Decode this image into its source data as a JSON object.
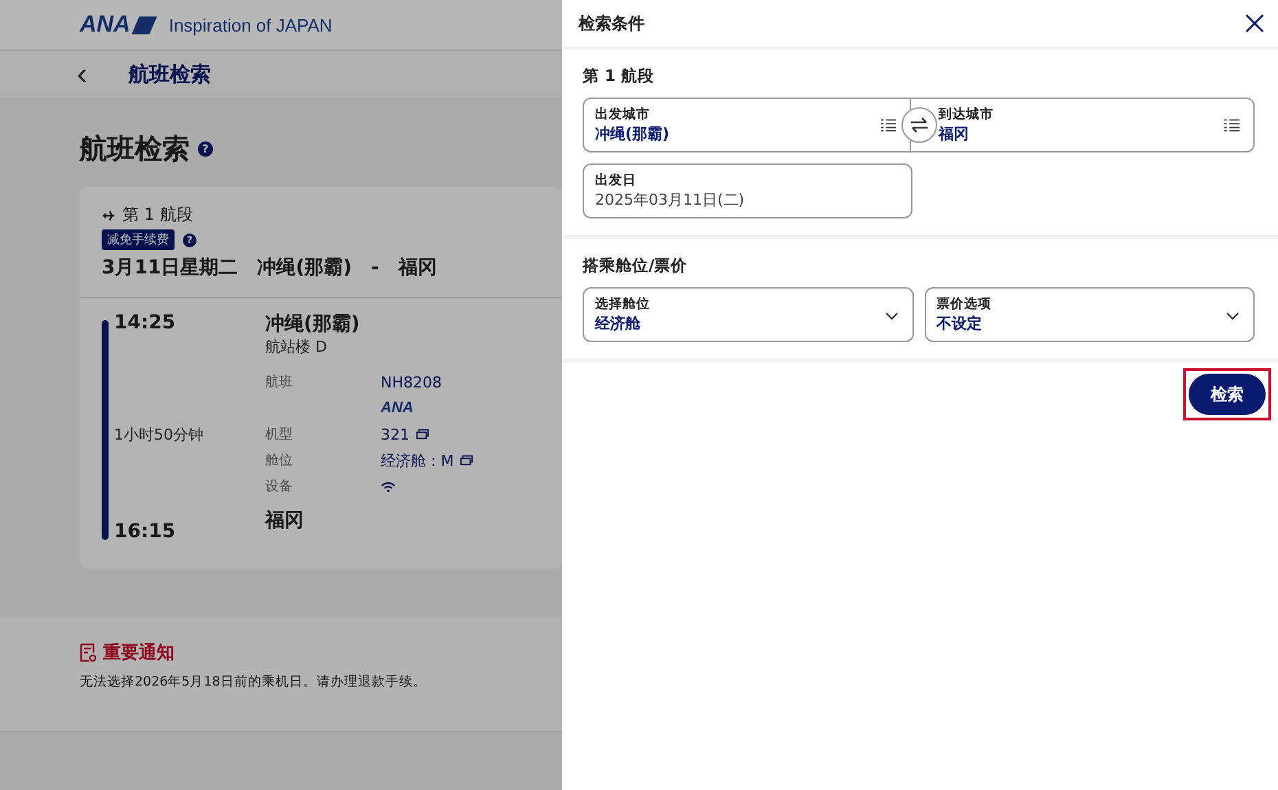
{
  "header": {
    "logo": "ANA",
    "tagline": "Inspiration of JAPAN"
  },
  "nav": {
    "back": "‹",
    "title": "航班检索"
  },
  "page": {
    "title": "航班检索",
    "help": "?",
    "segment": {
      "label": "第 1 航段",
      "badge": "减免手续费",
      "badge_help": "?",
      "route": "3月11日星期二　冲绳(那霸)　-　福冈",
      "departure": {
        "time": "14:25",
        "city": "冲绳(那霸)",
        "terminal": "航站楼 D"
      },
      "duration": "1小时50分钟",
      "details": [
        {
          "label": "航班",
          "value": "NH8208",
          "kind": "text"
        },
        {
          "value": "ANA",
          "kind": "logo"
        },
        {
          "label": "机型",
          "value": "321",
          "kind": "popup"
        },
        {
          "label": "舱位",
          "value": "经济舱 : M",
          "kind": "popup"
        },
        {
          "label": "设备",
          "kind": "wifi"
        }
      ],
      "arrival": {
        "time": "16:15",
        "city": "福冈"
      }
    }
  },
  "notice": {
    "title": "重要通知",
    "text": "无法选择2026年5月18日前的乘机日。请办理退款手续。"
  },
  "drawer": {
    "title": "检索条件",
    "leg": {
      "title": "第 1 航段",
      "from": {
        "label": "出发城市",
        "value": "冲绳(那霸)"
      },
      "to": {
        "label": "到达城市",
        "value": "福冈"
      },
      "date": {
        "label": "出发日",
        "value": "2025年03月11日(二)"
      }
    },
    "fare": {
      "title": "搭乘舱位/票价",
      "selects": [
        {
          "label": "选择舱位",
          "value": "经济舱"
        },
        {
          "label": "票价选项",
          "value": "不设定"
        }
      ]
    },
    "search": {
      "label": "检索",
      "highlighted": true
    }
  }
}
